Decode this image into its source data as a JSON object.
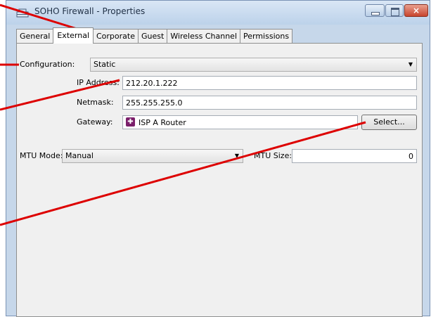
{
  "window": {
    "title": "SOHO Firewall - Properties",
    "icon": "firewall-icon",
    "controls": {
      "minimize": "minimize-icon",
      "maximize": "maximize-icon",
      "close": "close-icon",
      "close_label": "×"
    }
  },
  "tabs": [
    {
      "label": "General"
    },
    {
      "label": "External",
      "active": true
    },
    {
      "label": "Corporate"
    },
    {
      "label": "Guest"
    },
    {
      "label": "Wireless Channel"
    },
    {
      "label": "Permissions"
    }
  ],
  "form": {
    "configuration": {
      "label": "Configuration:",
      "value": "Static"
    },
    "ip_address": {
      "label": "IP Address:",
      "value": "212.20.1.222"
    },
    "netmask": {
      "label": "Netmask:",
      "value": "255.255.255.0"
    },
    "gateway": {
      "label": "Gateway:",
      "value": "ISP A Router",
      "icon": "router-icon",
      "icon_glyph": "✚"
    },
    "select_button": "Select...",
    "mtu_mode": {
      "label": "MTU Mode:",
      "value": "Manual"
    },
    "mtu_size": {
      "label": "MTU Size:",
      "value": "0"
    }
  },
  "colors": {
    "callout": "#dd0000",
    "title_bar": "#c6d7ea",
    "close_button": "#c8452e"
  }
}
